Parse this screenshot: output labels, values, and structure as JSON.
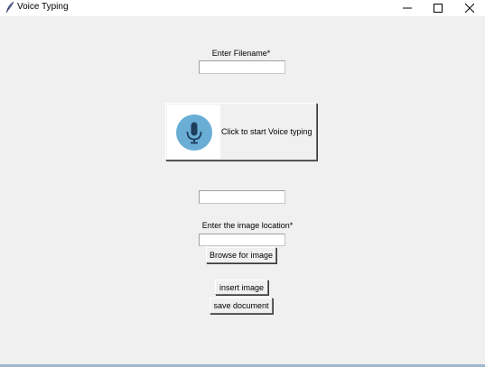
{
  "window": {
    "title": "Voice Typing",
    "minimize_glyph": "—",
    "maximize_glyph": "☐",
    "close_glyph": "✕"
  },
  "form": {
    "filename_label": "Enter Filename*",
    "filename_value": "",
    "voice_button_label": "Click to start Voice typing",
    "voice_icon": "microphone-icon",
    "transcript_value": "",
    "image_location_label": "Enter the image location*",
    "image_location_value": "",
    "browse_button_label": "Browse for image",
    "insert_button_label": "insert image",
    "save_button_label": "save document"
  },
  "colors": {
    "background": "#f0f0f0",
    "mic_circle": "#6aaed6",
    "mic_glyph": "#1f3d5c"
  }
}
